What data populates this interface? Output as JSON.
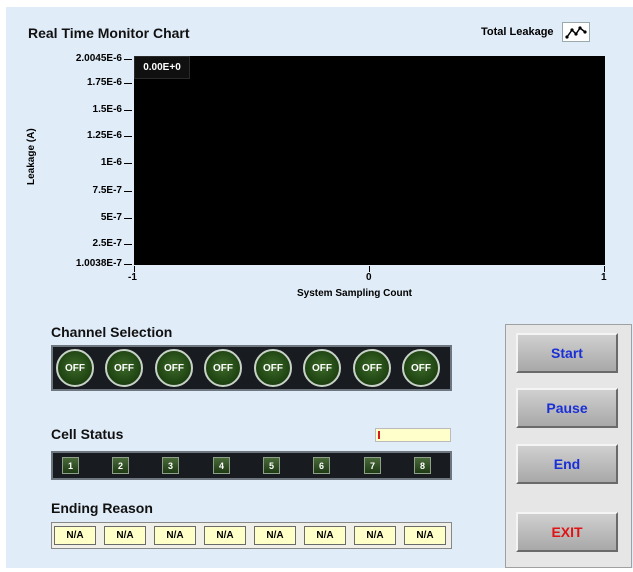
{
  "chart": {
    "title": "Real Time Monitor Chart",
    "legend_label": "Total Leakage",
    "cursor_readout": "0.00E+0",
    "ylabel": "Leakage (A)",
    "xlabel": "System Sampling Count",
    "yticks": [
      "2.0045E-6",
      "1.75E-6",
      "1.5E-6",
      "1.25E-6",
      "1E-6",
      "7.5E-7",
      "5E-7",
      "2.5E-7",
      "1.0038E-7"
    ],
    "xticks": [
      "-1",
      "0",
      "1"
    ],
    "background_color": "#000000"
  },
  "chart_data": {
    "type": "line",
    "title": "Real Time Monitor Chart",
    "xlabel": "System Sampling Count",
    "ylabel": "Leakage (A)",
    "xlim": [
      -1,
      1
    ],
    "ylim": [
      1.0038e-07,
      2.0045e-06
    ],
    "series": [
      {
        "name": "Total Leakage",
        "x": [],
        "y": []
      }
    ],
    "grid": false,
    "legend": "top-right"
  },
  "channel_selection": {
    "label": "Channel Selection",
    "buttons": [
      "OFF",
      "OFF",
      "OFF",
      "OFF",
      "OFF",
      "OFF",
      "OFF",
      "OFF"
    ]
  },
  "cell_status": {
    "label": "Cell Status",
    "cells": [
      "1",
      "2",
      "3",
      "4",
      "5",
      "6",
      "7",
      "8"
    ],
    "progress": 0.02
  },
  "ending_reason": {
    "label": "Ending Reason",
    "values": [
      "N/A",
      "N/A",
      "N/A",
      "N/A",
      "N/A",
      "N/A",
      "N/A",
      "N/A"
    ]
  },
  "controls": {
    "start": "Start",
    "pause": "Pause",
    "end": "End",
    "exit": "EXIT",
    "normal_color": "#1a2fd6",
    "exit_color": "#e01414"
  }
}
